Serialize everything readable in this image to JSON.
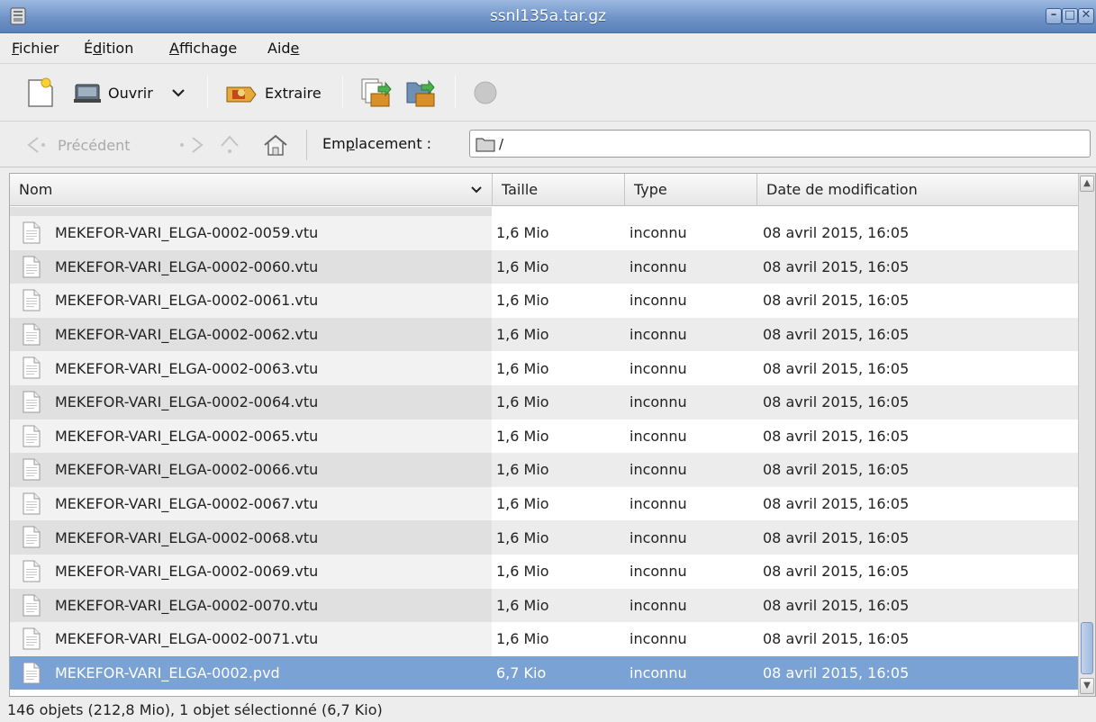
{
  "window": {
    "title": "ssnl135a.tar.gz"
  },
  "menu": [
    {
      "label_pre": "",
      "label_u": "F",
      "label_post": "ichier"
    },
    {
      "label_pre": "É",
      "label_u": "d",
      "label_post": "ition"
    },
    {
      "label_pre": "",
      "label_u": "A",
      "label_post": "ffichage"
    },
    {
      "label_pre": "Aid",
      "label_u": "e",
      "label_post": ""
    }
  ],
  "toolbar": {
    "open_label": "Ouvrir",
    "extract_label": "Extraire"
  },
  "location": {
    "prev_label": "Précédent",
    "label_pre": "Em",
    "label_u": "p",
    "label_post": "lacement :",
    "value": "/"
  },
  "columns": {
    "name": "Nom",
    "size": "Taille",
    "type": "Type",
    "date": "Date de modification"
  },
  "files": [
    {
      "name": "MEKEFOR-VARI_ELGA-0002-0059.vtu",
      "size": "1,6 Mio",
      "type": "inconnu",
      "date": "08 avril 2015, 16:05"
    },
    {
      "name": "MEKEFOR-VARI_ELGA-0002-0060.vtu",
      "size": "1,6 Mio",
      "type": "inconnu",
      "date": "08 avril 2015, 16:05"
    },
    {
      "name": "MEKEFOR-VARI_ELGA-0002-0061.vtu",
      "size": "1,6 Mio",
      "type": "inconnu",
      "date": "08 avril 2015, 16:05"
    },
    {
      "name": "MEKEFOR-VARI_ELGA-0002-0062.vtu",
      "size": "1,6 Mio",
      "type": "inconnu",
      "date": "08 avril 2015, 16:05"
    },
    {
      "name": "MEKEFOR-VARI_ELGA-0002-0063.vtu",
      "size": "1,6 Mio",
      "type": "inconnu",
      "date": "08 avril 2015, 16:05"
    },
    {
      "name": "MEKEFOR-VARI_ELGA-0002-0064.vtu",
      "size": "1,6 Mio",
      "type": "inconnu",
      "date": "08 avril 2015, 16:05"
    },
    {
      "name": "MEKEFOR-VARI_ELGA-0002-0065.vtu",
      "size": "1,6 Mio",
      "type": "inconnu",
      "date": "08 avril 2015, 16:05"
    },
    {
      "name": "MEKEFOR-VARI_ELGA-0002-0066.vtu",
      "size": "1,6 Mio",
      "type": "inconnu",
      "date": "08 avril 2015, 16:05"
    },
    {
      "name": "MEKEFOR-VARI_ELGA-0002-0067.vtu",
      "size": "1,6 Mio",
      "type": "inconnu",
      "date": "08 avril 2015, 16:05"
    },
    {
      "name": "MEKEFOR-VARI_ELGA-0002-0068.vtu",
      "size": "1,6 Mio",
      "type": "inconnu",
      "date": "08 avril 2015, 16:05"
    },
    {
      "name": "MEKEFOR-VARI_ELGA-0002-0069.vtu",
      "size": "1,6 Mio",
      "type": "inconnu",
      "date": "08 avril 2015, 16:05"
    },
    {
      "name": "MEKEFOR-VARI_ELGA-0002-0070.vtu",
      "size": "1,6 Mio",
      "type": "inconnu",
      "date": "08 avril 2015, 16:05"
    },
    {
      "name": "MEKEFOR-VARI_ELGA-0002-0071.vtu",
      "size": "1,6 Mio",
      "type": "inconnu",
      "date": "08 avril 2015, 16:05"
    },
    {
      "name": "MEKEFOR-VARI_ELGA-0002.pvd",
      "size": "6,7 Kio",
      "type": "inconnu",
      "date": "08 avril 2015, 16:05",
      "selected": true
    }
  ],
  "status": {
    "text": "146 objets (212,8 Mio), 1 objet sélectionné (6,7 Kio)"
  },
  "colors": {
    "titlebar": "#6f93c8",
    "selection": "#7ba2d4"
  }
}
